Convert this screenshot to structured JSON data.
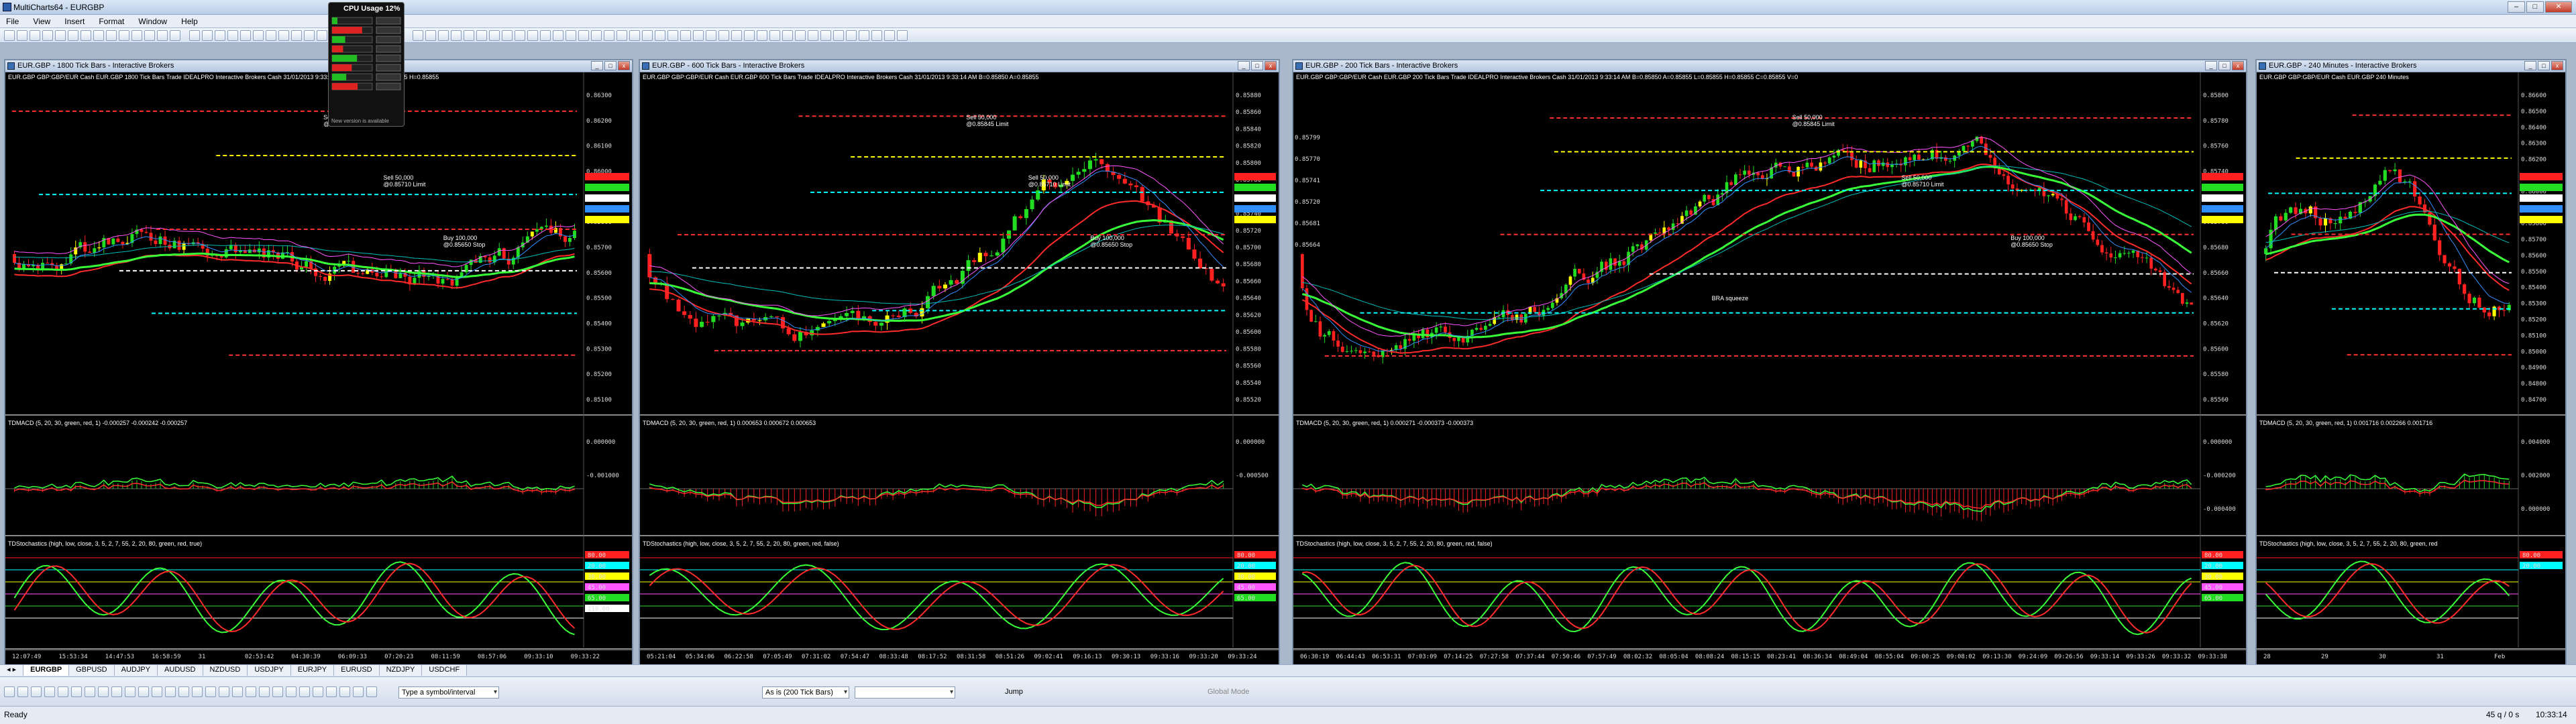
{
  "app": {
    "title": "MultiCharts64 - EURGBP"
  },
  "menu": [
    "File",
    "View",
    "Insert",
    "Format",
    "Window",
    "Help"
  ],
  "cpu_gadget": {
    "title": "CPU Usage 12%",
    "status": "New version is available"
  },
  "windows": [
    {
      "title": "EUR.GBP - 1800 Tick Bars - Interactive Brokers",
      "info": "EUR.GBP  GBP:GBP/EUR Cash EUR.GBP  1800 Tick Bars  Trade  IDEALPRO  Interactive Brokers  Cash  31/01/2013  9:33:14 AM  B=0.85850  A=0.85855  H=0.85855",
      "price_labels": [
        "0.86300",
        "0.86200",
        "0.86100",
        "0.86000",
        "0.85900",
        "0.85800",
        "0.85700",
        "0.85600",
        "0.85500",
        "0.85400",
        "0.85300",
        "0.85200",
        "0.85100"
      ],
      "annotations": [
        "Sell 50,000",
        "@0.85845 Limit",
        "Sell 50,000",
        "@0.85710 Limit",
        "Buy 100,000",
        "@0.85650 Stop"
      ],
      "macd_title": "TDMACD (5, 20, 30, green, red, 1)  -0.000257  -0.000242  -0.000257",
      "macd_labels": [
        "0.000000",
        "-0.001000"
      ],
      "stoch_title": "TDStochastics (high, low, close, 3, 5, 2, 7, 55, 2, 20, 80, green, red, true)",
      "stoch_vals": [
        "80.00",
        "20.00",
        "30.00",
        "45.00",
        "65.00",
        "110.00"
      ],
      "time_labels": [
        "12:07:49",
        "15:53:34",
        "14:47:53",
        "16:58:59",
        "31",
        "02:53:42",
        "04:30:39",
        "06:09:33",
        "07:20:23",
        "08:11:59",
        "08:57:06",
        "09:33:10",
        "09:33:22"
      ]
    },
    {
      "title": "EUR.GBP - 600 Tick Bars - Interactive Brokers",
      "info": "EUR.GBP  GBP:GBP/EUR Cash EUR.GBP  600 Tick Bars  Trade  IDEALPRO  Interactive Brokers  Cash  31/01/2013  9:33:14 AM  B=0.85850  A=0.85855",
      "price_labels": [
        "0.85880",
        "0.85860",
        "0.85840",
        "0.85820",
        "0.85800",
        "0.85780",
        "0.85760",
        "0.85740",
        "0.85720",
        "0.85700",
        "0.85680",
        "0.85660",
        "0.85640",
        "0.85620",
        "0.85600",
        "0.85580",
        "0.85560",
        "0.85540",
        "0.85520"
      ],
      "annotations": [
        "Sell 50,000",
        "@0.85845 Limit",
        "Sell 50,000",
        "@0.85710 Limit",
        "Buy 100,000",
        "@0.85650 Stop"
      ],
      "macd_title": "TDMACD (5, 20, 30, green, red, 1)  0.000653  0.000672  0.000653",
      "macd_labels": [
        "0.000000",
        "-0.000500"
      ],
      "stoch_title": "TDStochastics (high, low, close, 3, 5, 2, 7, 55, 2, 20, 80, green, red, false)",
      "stoch_vals": [
        "80.00",
        "20.00",
        "30.00",
        "45.00",
        "65.00"
      ],
      "time_labels": [
        "05:21:04",
        "05:34:06",
        "06:22:58",
        "07:05:49",
        "07:31:02",
        "07:54:47",
        "08:33:48",
        "08:17:52",
        "08:31:58",
        "08:51:26",
        "09:02:41",
        "09:16:13",
        "09:30:13",
        "09:33:16",
        "09:33:20",
        "09:33:24"
      ]
    },
    {
      "title": "EUR.GBP - 200 Tick Bars - Interactive Brokers",
      "info": "EUR.GBP  GBP:GBP/EUR Cash EUR.GBP  200 Tick Bars  Trade  IDEALPRO  Interactive Brokers  Cash  31/01/2013  9:33:14 AM  B=0.85850  A=0.85855  L=0.85855  H=0.85855  C=0.85855  V=0",
      "price_labels": [
        "0.85800",
        "0.85780",
        "0.85760",
        "0.85740",
        "0.85720",
        "0.85700",
        "0.85680",
        "0.85660",
        "0.85640",
        "0.85620",
        "0.85600",
        "0.85580",
        "0.85560"
      ],
      "left_labels": [
        "0.85799",
        "0.85770",
        "0.85741",
        "0.85720",
        "0.85681",
        "0.85664"
      ],
      "annotations": [
        "Sell 50,000",
        "@0.85845 Limit",
        "Sell 50,000",
        "@0.85710 Limit",
        "Buy 100,000",
        "@0.85650 Stop",
        "BRA squeeze"
      ],
      "macd_title": "TDMACD (5, 20, 30, green, red, 1)  0.000271  -0.000373  -0.000373",
      "macd_labels": [
        "0.000000",
        "-0.000200",
        "-0.000400"
      ],
      "stoch_title": "TDStochastics (high, low, close, 3, 5, 2, 7, 55, 2, 20, 80, green, red, false)",
      "stoch_vals": [
        "80.00",
        "20.00",
        "30.00",
        "45.00",
        "65.00"
      ],
      "time_labels": [
        "06:30:19",
        "06:44:43",
        "06:53:31",
        "07:03:09",
        "07:14:25",
        "07:27:58",
        "07:37:44",
        "07:50:46",
        "07:57:49",
        "08:02:32",
        "08:05:04",
        "08:08:24",
        "08:15:15",
        "08:23:41",
        "08:36:34",
        "08:49:04",
        "08:55:04",
        "09:00:25",
        "09:08:02",
        "09:13:30",
        "09:24:09",
        "09:26:56",
        "09:33:14",
        "09:33:26",
        "09:33:32",
        "09:33:38"
      ]
    },
    {
      "title": "EUR.GBP - 240 Minutes - Interactive Brokers",
      "info": "EUR.GBP  GBP:GBP/EUR Cash EUR.GBP  240 Minutes",
      "price_labels": [
        "0.86600",
        "0.86500",
        "0.86400",
        "0.86300",
        "0.86200",
        "0.86100",
        "0.86000",
        "0.85900",
        "0.85800",
        "0.85700",
        "0.85600",
        "0.85500",
        "0.85400",
        "0.85300",
        "0.85200",
        "0.85100",
        "0.85000",
        "0.84900",
        "0.84800",
        "0.84700"
      ],
      "annotations": [],
      "macd_title": "TDMACD (5, 20, 30, green, red, 1)  0.001716  0.002266  0.001716",
      "macd_labels": [
        "0.004000",
        "0.002000",
        "0.000000"
      ],
      "stoch_title": "TDStochastics (high, low, close, 3, 5, 2, 7, 55, 2, 20, 80, green, red",
      "stoch_vals": [
        "80.00",
        "20.00"
      ],
      "time_labels": [
        "28",
        "29",
        "30",
        "31",
        "Feb"
      ]
    }
  ],
  "tabs": [
    "EURGBP",
    "GBPUSD",
    "AUDJPY",
    "AUDUSD",
    "NZDUSD",
    "USDJPY",
    "EURJPY",
    "EURUSD",
    "NZDJPY",
    "USDCHF"
  ],
  "drawbar": {
    "symbol_placeholder": "Type a symbol/interval",
    "resolution": "As is (200 Tick Bars)",
    "jump": "Jump",
    "global_mode": "Global Mode"
  },
  "status": {
    "left": "Ready",
    "right1": "45 q / 0 s",
    "right2": "10:33:14"
  },
  "colors": {
    "up": "#22dd22",
    "down": "#ff2020",
    "bg": "#000000",
    "accent_yellow": "#ffff00",
    "cyan": "#00ffff"
  }
}
